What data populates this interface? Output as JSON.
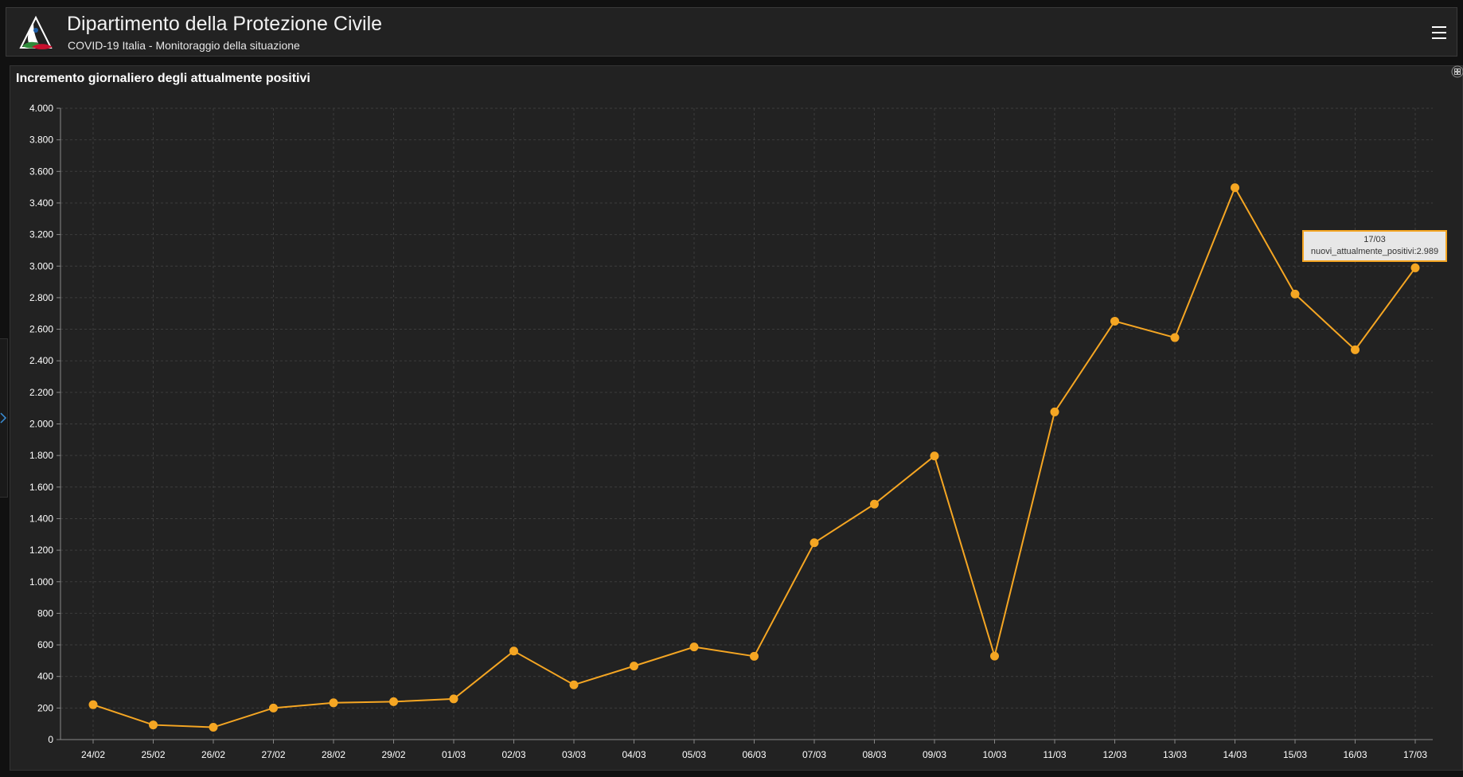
{
  "header": {
    "title": "Dipartimento della Protezione Civile",
    "subtitle": "COVID-19 Italia - Monitoraggio della situazione",
    "logo_icon": "protezione-civile-logo",
    "menu_icon": "hamburger-menu-icon"
  },
  "colors": {
    "background": "#111111",
    "panel": "#222222",
    "series": "#f5a623",
    "grid": "#3c3c3c",
    "axis_text": "#ffffff"
  },
  "chart_data": {
    "type": "line",
    "title": "Incremento giornaliero degli attualmente positivi",
    "xlabel": "",
    "ylabel": "",
    "ylim": [
      0,
      4000
    ],
    "yticks": [
      "0",
      "200",
      "400",
      "600",
      "800",
      "1.000",
      "1.200",
      "1.400",
      "1.600",
      "1.800",
      "2.000",
      "2.200",
      "2.400",
      "2.600",
      "2.800",
      "3.000",
      "3.200",
      "3.400",
      "3.600",
      "3.800",
      "4.000"
    ],
    "grid": true,
    "categories": [
      "24/02",
      "25/02",
      "26/02",
      "27/02",
      "28/02",
      "29/02",
      "01/03",
      "02/03",
      "03/03",
      "04/03",
      "05/03",
      "06/03",
      "07/03",
      "08/03",
      "09/03",
      "10/03",
      "11/03",
      "12/03",
      "13/03",
      "14/03",
      "15/03",
      "16/03",
      "17/03"
    ],
    "series": [
      {
        "name": "nuovi_attualmente_positivi",
        "values": [
          221,
          93,
          78,
          200,
          233,
          240,
          258,
          561,
          347,
          466,
          587,
          528,
          1247,
          1492,
          1797,
          529,
          2076,
          2651,
          2547,
          3497,
          2823,
          2470,
          2989
        ]
      }
    ],
    "tooltip": {
      "category": "17/03",
      "label": "nuovi_attualmente_positivi:2.989"
    }
  }
}
